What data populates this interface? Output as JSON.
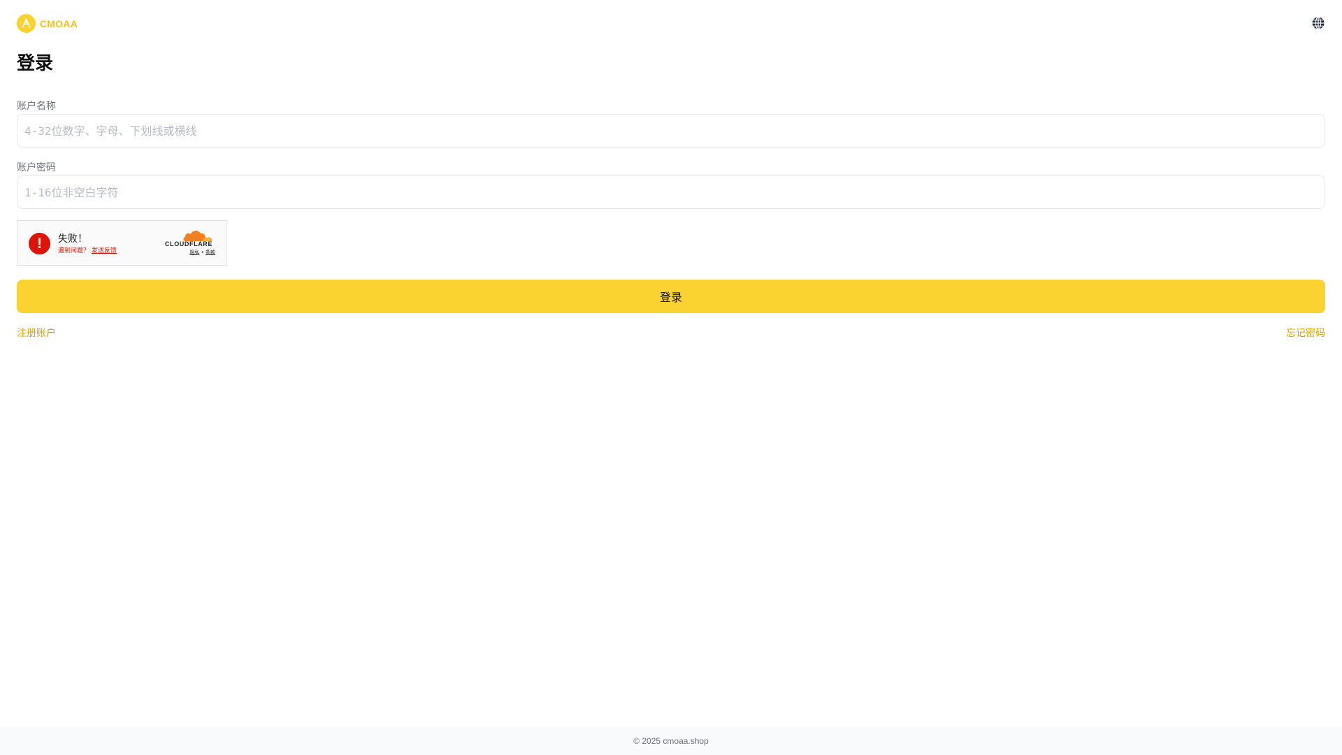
{
  "header": {
    "brand": "CMOAA",
    "logo_icon": "logo-a-icon",
    "language_icon": "globe-icon",
    "accent_color": "#fbd331"
  },
  "form": {
    "title": "登录",
    "username": {
      "label": "账户名称",
      "placeholder": "4-32位数字、字母、下划线或横线",
      "value": ""
    },
    "password": {
      "label": "账户密码",
      "placeholder": "1-16位非空白字符",
      "value": ""
    },
    "captcha": {
      "status": "失败！",
      "question": "遇到问题？",
      "feedback_link": "发送反馈",
      "brand": "CLOUDFLARE",
      "privacy_link": "隐私",
      "separator": "•",
      "terms_link": "条款",
      "error_color": "#de1303"
    },
    "submit_label": "登录",
    "register_link": "注册账户",
    "forgot_link": "忘记密码"
  },
  "footer": {
    "copyright": "© 2025 cmoaa.shop"
  }
}
